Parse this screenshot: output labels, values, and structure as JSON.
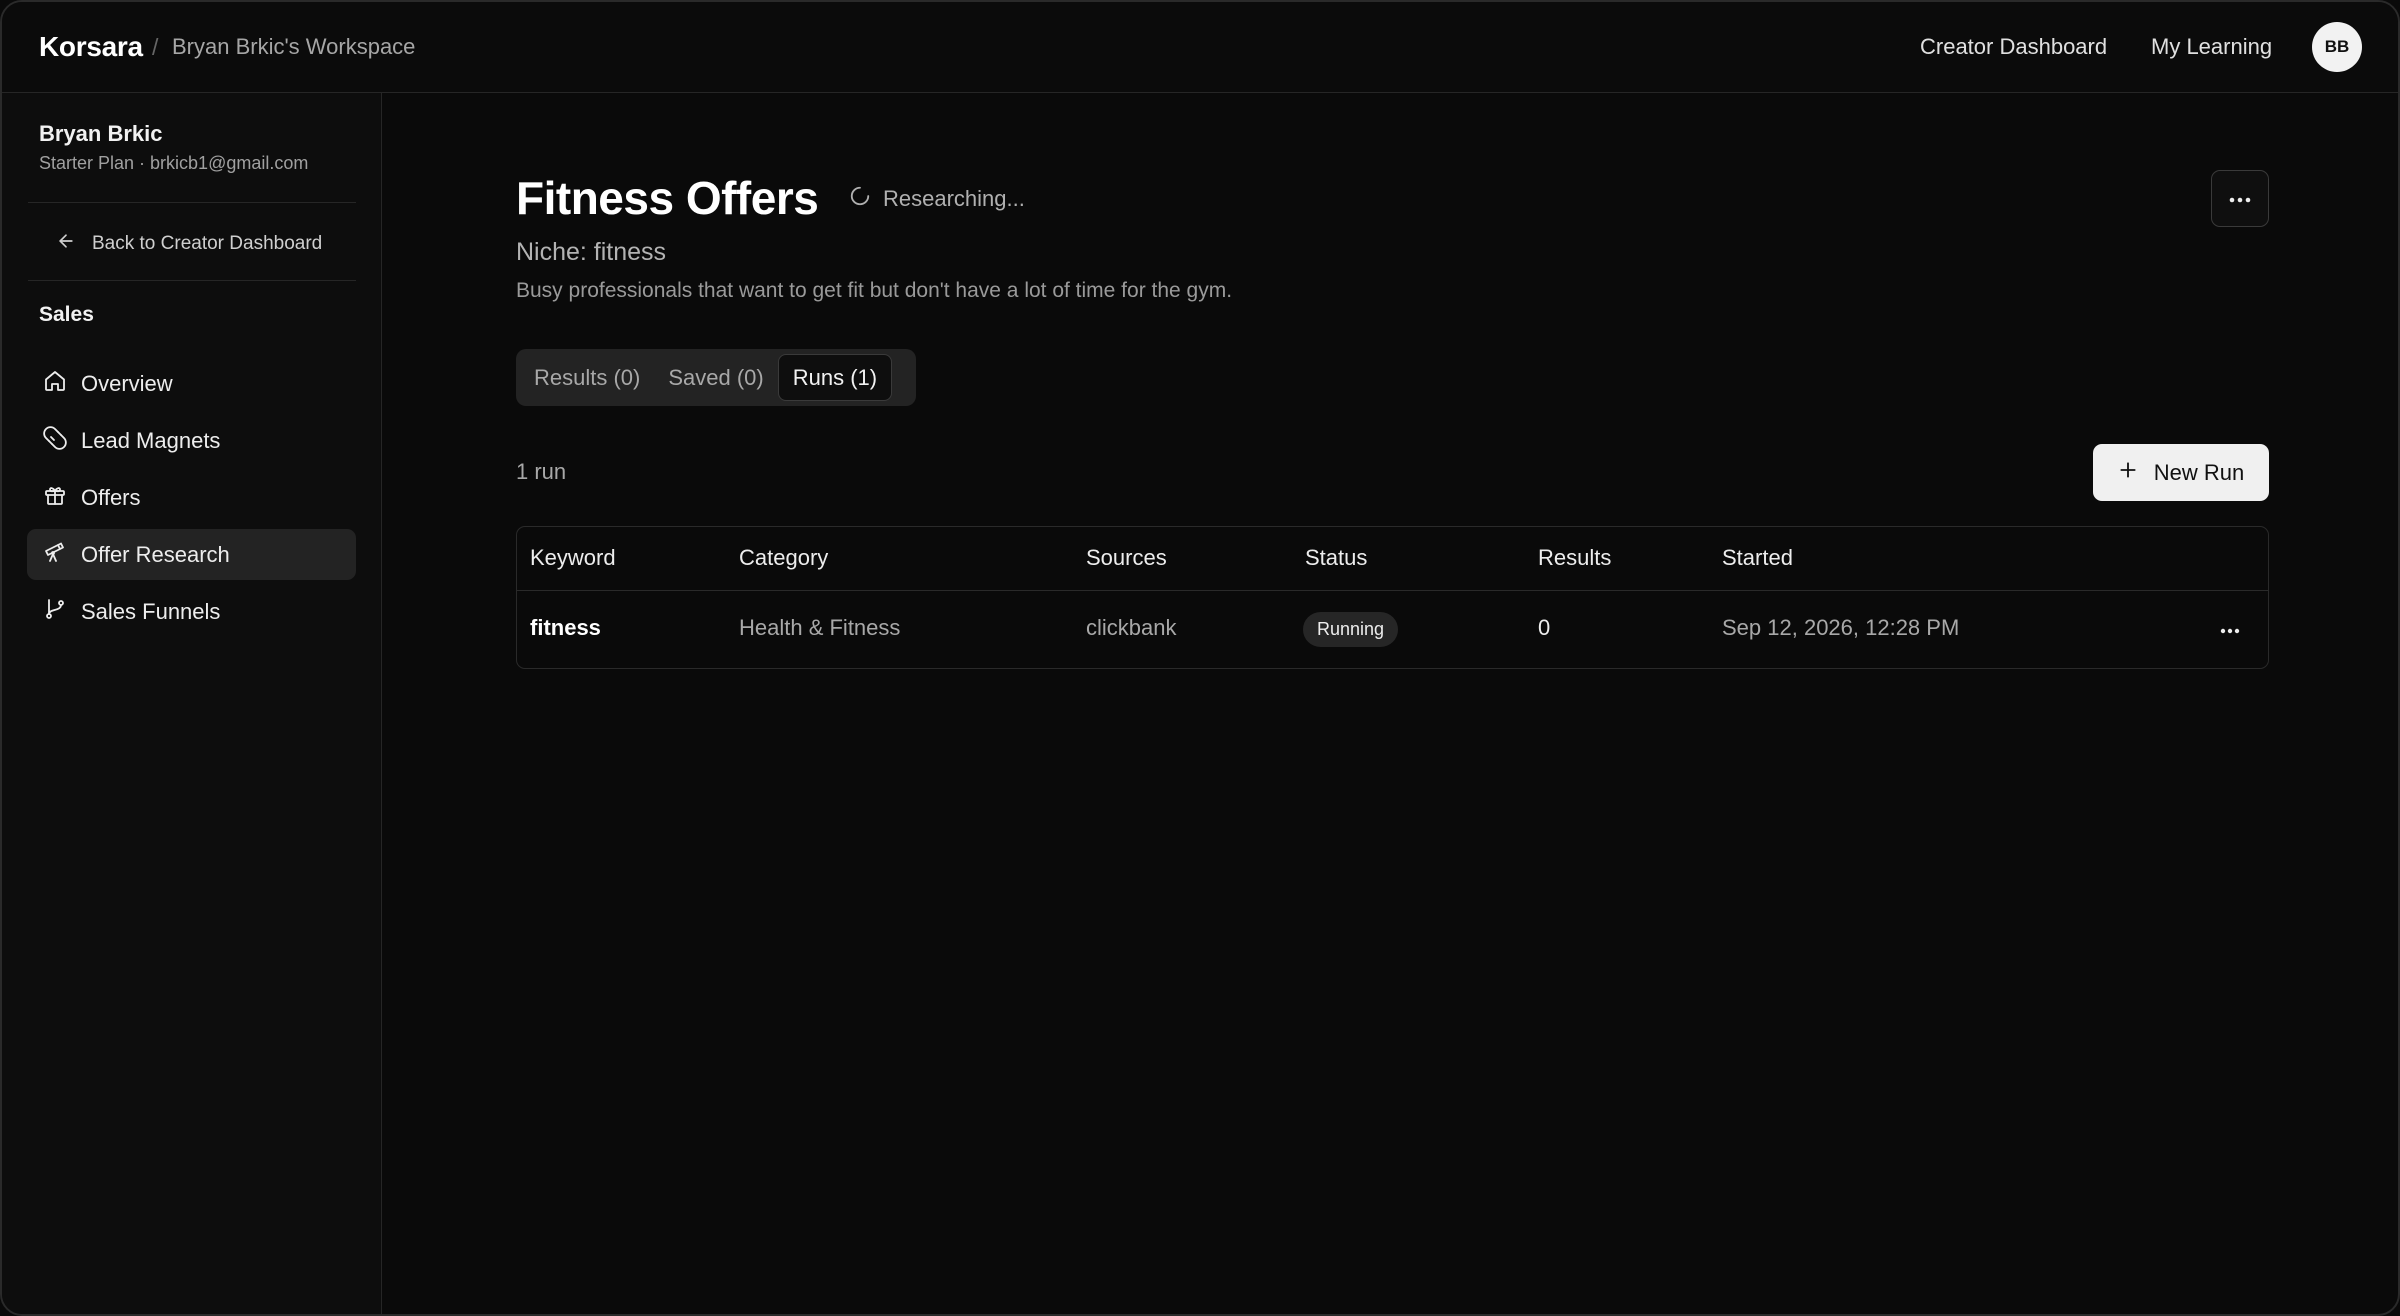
{
  "header": {
    "brand": "Korsara",
    "separator": "/",
    "workspace": "Bryan Brkic's Workspace",
    "nav": [
      "Creator Dashboard",
      "My Learning"
    ],
    "avatar_initials": "BB"
  },
  "sidebar": {
    "user_name": "Bryan Brkic",
    "user_meta": "Starter Plan · brkicb1@gmail.com",
    "back_label": "Back to Creator Dashboard",
    "section": "Sales",
    "items": [
      {
        "label": "Overview",
        "icon": "home-icon"
      },
      {
        "label": "Lead Magnets",
        "icon": "magnet-icon"
      },
      {
        "label": "Offers",
        "icon": "gift-icon"
      },
      {
        "label": "Offer Research",
        "icon": "telescope-icon",
        "active": true
      },
      {
        "label": "Sales Funnels",
        "icon": "git-branch-icon"
      }
    ]
  },
  "page": {
    "title": "Fitness Offers",
    "status": "Researching...",
    "niche": "Niche: fitness",
    "description": "Busy professionals that want to get fit but don't have a lot of time for the gym."
  },
  "tabs": [
    {
      "label": "Results (0)",
      "active": false
    },
    {
      "label": "Saved (0)",
      "active": false
    },
    {
      "label": "Runs (1)",
      "active": true
    }
  ],
  "runs": {
    "count_label": "1 run",
    "new_run_label": "New Run",
    "columns": [
      "Keyword",
      "Category",
      "Sources",
      "Status",
      "Results",
      "Started"
    ],
    "rows": [
      {
        "keyword": "fitness",
        "category": "Health & Fitness",
        "sources": "clickbank",
        "status": "Running",
        "results": "0",
        "started": "Sep 12, 2026, 12:28 PM"
      }
    ]
  }
}
